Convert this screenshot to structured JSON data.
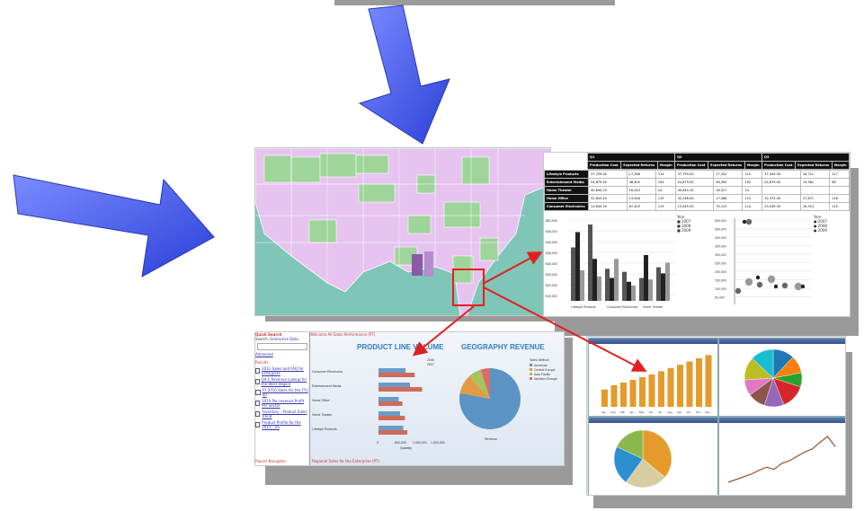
{
  "colors": {
    "arrow_blue": "#4a5fe6",
    "callout_red": "#e02020",
    "map_pink": "#e6c4ef",
    "map_green": "#9fd49a",
    "map_purple": "#8a5aa8",
    "ocean": "#7fc5b8",
    "bar_orange": "#e59a2c",
    "bar_dark": "#444444"
  },
  "icons": [
    "down-arrow-icon",
    "right-arrow-icon",
    "callout-arrow-icon"
  ],
  "financial_table": {
    "group_headers": [
      "Q1",
      "Q2",
      "Q3"
    ],
    "sub_headers": [
      "Production Cost",
      "Expected Returns",
      "Margin"
    ],
    "rows": [
      {
        "label": "Lifestyle Products",
        "values": [
          "37,759.50",
          "17,268",
          "114",
          "37,759.50",
          "17,322",
          "112",
          "37,459.30",
          "18,711",
          "117"
        ]
      },
      {
        "label": "Entertainment Media",
        "values": [
          "54,879.50",
          "46,400",
          "104",
          "54,879.50",
          "46,392",
          "102",
          "54,879.50",
          "19,561",
          "98"
        ]
      },
      {
        "label": "Home Theater",
        "values": [
          "40,840.10",
          "16,240",
          "24",
          "40,840.10",
          "16,527",
          "24",
          "",
          "",
          ""
        ]
      },
      {
        "label": "Home Office",
        "values": [
          "32,843.40",
          "13,548",
          "115",
          "32,248.40",
          "17,588",
          "112",
          "32,375.40",
          "27,871",
          "116"
        ]
      },
      {
        "label": "Consumer Electronics",
        "values": [
          "13,849.30",
          "67,403",
          "113",
          "13,549.30",
          "75,123",
          "114",
          "23,549.30",
          "16,313",
          "115"
        ]
      }
    ]
  },
  "bar_chart": {
    "categories": [
      "Lifestyle Products",
      "Consumer Electronics",
      "Home Theater"
    ],
    "legend": [
      "2007",
      "2008",
      "2009"
    ],
    "yticks": [
      "$50,000",
      "$45,000",
      "$40,000",
      "$35,000",
      "$30,000",
      "$25,000",
      "$20,000",
      "$15,000"
    ]
  },
  "scatter_chart": {
    "legend": [
      "2007",
      "2008",
      "2009"
    ],
    "yticks": [
      "500,000",
      "450,000",
      "400,000",
      "350,000",
      "300,000",
      "250,000",
      "200,000",
      "150,000",
      "100,000",
      "50,000"
    ]
  },
  "dashboard": {
    "left_header": "Quick Search",
    "search_label": "Search:",
    "search_value": "Enterprise Data",
    "advanced_link": "Advanced",
    "results_header": "Results",
    "results": [
      "2011 Sales and FAQ for Enterprise",
      "Q4-1 Revenue Lookup for the West Region",
      "FY 2010 Sales for the FY2 00",
      "2010 Per revenue Profit Per Sector",
      "Inventory - Product Sales Trend",
      "Product Profile for the 2011 - US"
    ],
    "bottom_left": "Report Navigator",
    "bottom_main": "Regional Sales for the Enterprise (PT)",
    "top_main": "Welcome All Sales Performance (PT)",
    "chart1_title": "PRODUCT LINE VOLUME",
    "chart1_categories": [
      "Consumer Electronics",
      "Entertainment Media",
      "Home Office",
      "Home Theater",
      "Lifestyle Products"
    ],
    "chart1_legend": [
      "2006",
      "2007"
    ],
    "chart1_xticks": [
      "0",
      "500,000",
      "1,000,000",
      "1,500,000"
    ],
    "chart1_xlabel": "Quantity",
    "chart2_title": "GEOGRAPHY REVENUE",
    "chart2_legend_title": "Sales Method",
    "chart2_legend": [
      "Americas",
      "Central Europe",
      "Asia Pacific",
      "Northern Europe"
    ],
    "chart2_label": "Revenue"
  },
  "quad": {
    "bar_values": [
      0.32,
      0.4,
      0.45,
      0.5,
      0.55,
      0.6,
      0.66,
      0.72,
      0.78,
      0.84,
      0.9,
      0.96
    ],
    "months": [
      "Jan",
      "Feb",
      "Mar",
      "Apr",
      "May",
      "Jun",
      "Jul",
      "Aug",
      "Sep",
      "Oct",
      "Nov",
      "Dec"
    ],
    "line_values": [
      0.1,
      0.15,
      0.2,
      0.25,
      0.32,
      0.38,
      0.34,
      0.45,
      0.5,
      0.58,
      0.66,
      0.72,
      0.84,
      0.95,
      0.76
    ],
    "pie1": [
      0.12,
      0.1,
      0.08,
      0.14,
      0.11,
      0.1,
      0.09,
      0.13,
      0.13
    ],
    "pie2": [
      0.36,
      0.24,
      0.22,
      0.18
    ]
  }
}
